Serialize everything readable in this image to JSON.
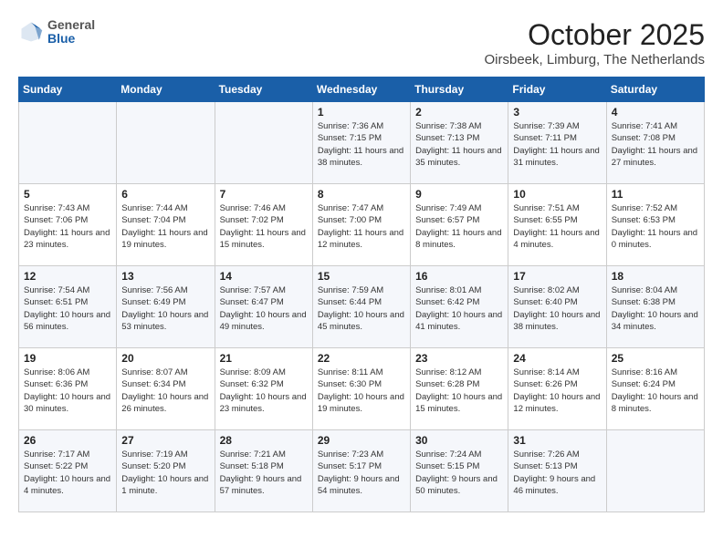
{
  "header": {
    "logo": {
      "general": "General",
      "blue": "Blue"
    },
    "month": "October 2025",
    "location": "Oirsbeek, Limburg, The Netherlands"
  },
  "weekdays": [
    "Sunday",
    "Monday",
    "Tuesday",
    "Wednesday",
    "Thursday",
    "Friday",
    "Saturday"
  ],
  "weeks": [
    [
      {
        "day": null,
        "sunrise": null,
        "sunset": null,
        "daylight": null
      },
      {
        "day": null,
        "sunrise": null,
        "sunset": null,
        "daylight": null
      },
      {
        "day": null,
        "sunrise": null,
        "sunset": null,
        "daylight": null
      },
      {
        "day": "1",
        "sunrise": "Sunrise: 7:36 AM",
        "sunset": "Sunset: 7:15 PM",
        "daylight": "Daylight: 11 hours and 38 minutes."
      },
      {
        "day": "2",
        "sunrise": "Sunrise: 7:38 AM",
        "sunset": "Sunset: 7:13 PM",
        "daylight": "Daylight: 11 hours and 35 minutes."
      },
      {
        "day": "3",
        "sunrise": "Sunrise: 7:39 AM",
        "sunset": "Sunset: 7:11 PM",
        "daylight": "Daylight: 11 hours and 31 minutes."
      },
      {
        "day": "4",
        "sunrise": "Sunrise: 7:41 AM",
        "sunset": "Sunset: 7:08 PM",
        "daylight": "Daylight: 11 hours and 27 minutes."
      }
    ],
    [
      {
        "day": "5",
        "sunrise": "Sunrise: 7:43 AM",
        "sunset": "Sunset: 7:06 PM",
        "daylight": "Daylight: 11 hours and 23 minutes."
      },
      {
        "day": "6",
        "sunrise": "Sunrise: 7:44 AM",
        "sunset": "Sunset: 7:04 PM",
        "daylight": "Daylight: 11 hours and 19 minutes."
      },
      {
        "day": "7",
        "sunrise": "Sunrise: 7:46 AM",
        "sunset": "Sunset: 7:02 PM",
        "daylight": "Daylight: 11 hours and 15 minutes."
      },
      {
        "day": "8",
        "sunrise": "Sunrise: 7:47 AM",
        "sunset": "Sunset: 7:00 PM",
        "daylight": "Daylight: 11 hours and 12 minutes."
      },
      {
        "day": "9",
        "sunrise": "Sunrise: 7:49 AM",
        "sunset": "Sunset: 6:57 PM",
        "daylight": "Daylight: 11 hours and 8 minutes."
      },
      {
        "day": "10",
        "sunrise": "Sunrise: 7:51 AM",
        "sunset": "Sunset: 6:55 PM",
        "daylight": "Daylight: 11 hours and 4 minutes."
      },
      {
        "day": "11",
        "sunrise": "Sunrise: 7:52 AM",
        "sunset": "Sunset: 6:53 PM",
        "daylight": "Daylight: 11 hours and 0 minutes."
      }
    ],
    [
      {
        "day": "12",
        "sunrise": "Sunrise: 7:54 AM",
        "sunset": "Sunset: 6:51 PM",
        "daylight": "Daylight: 10 hours and 56 minutes."
      },
      {
        "day": "13",
        "sunrise": "Sunrise: 7:56 AM",
        "sunset": "Sunset: 6:49 PM",
        "daylight": "Daylight: 10 hours and 53 minutes."
      },
      {
        "day": "14",
        "sunrise": "Sunrise: 7:57 AM",
        "sunset": "Sunset: 6:47 PM",
        "daylight": "Daylight: 10 hours and 49 minutes."
      },
      {
        "day": "15",
        "sunrise": "Sunrise: 7:59 AM",
        "sunset": "Sunset: 6:44 PM",
        "daylight": "Daylight: 10 hours and 45 minutes."
      },
      {
        "day": "16",
        "sunrise": "Sunrise: 8:01 AM",
        "sunset": "Sunset: 6:42 PM",
        "daylight": "Daylight: 10 hours and 41 minutes."
      },
      {
        "day": "17",
        "sunrise": "Sunrise: 8:02 AM",
        "sunset": "Sunset: 6:40 PM",
        "daylight": "Daylight: 10 hours and 38 minutes."
      },
      {
        "day": "18",
        "sunrise": "Sunrise: 8:04 AM",
        "sunset": "Sunset: 6:38 PM",
        "daylight": "Daylight: 10 hours and 34 minutes."
      }
    ],
    [
      {
        "day": "19",
        "sunrise": "Sunrise: 8:06 AM",
        "sunset": "Sunset: 6:36 PM",
        "daylight": "Daylight: 10 hours and 30 minutes."
      },
      {
        "day": "20",
        "sunrise": "Sunrise: 8:07 AM",
        "sunset": "Sunset: 6:34 PM",
        "daylight": "Daylight: 10 hours and 26 minutes."
      },
      {
        "day": "21",
        "sunrise": "Sunrise: 8:09 AM",
        "sunset": "Sunset: 6:32 PM",
        "daylight": "Daylight: 10 hours and 23 minutes."
      },
      {
        "day": "22",
        "sunrise": "Sunrise: 8:11 AM",
        "sunset": "Sunset: 6:30 PM",
        "daylight": "Daylight: 10 hours and 19 minutes."
      },
      {
        "day": "23",
        "sunrise": "Sunrise: 8:12 AM",
        "sunset": "Sunset: 6:28 PM",
        "daylight": "Daylight: 10 hours and 15 minutes."
      },
      {
        "day": "24",
        "sunrise": "Sunrise: 8:14 AM",
        "sunset": "Sunset: 6:26 PM",
        "daylight": "Daylight: 10 hours and 12 minutes."
      },
      {
        "day": "25",
        "sunrise": "Sunrise: 8:16 AM",
        "sunset": "Sunset: 6:24 PM",
        "daylight": "Daylight: 10 hours and 8 minutes."
      }
    ],
    [
      {
        "day": "26",
        "sunrise": "Sunrise: 7:17 AM",
        "sunset": "Sunset: 5:22 PM",
        "daylight": "Daylight: 10 hours and 4 minutes."
      },
      {
        "day": "27",
        "sunrise": "Sunrise: 7:19 AM",
        "sunset": "Sunset: 5:20 PM",
        "daylight": "Daylight: 10 hours and 1 minute."
      },
      {
        "day": "28",
        "sunrise": "Sunrise: 7:21 AM",
        "sunset": "Sunset: 5:18 PM",
        "daylight": "Daylight: 9 hours and 57 minutes."
      },
      {
        "day": "29",
        "sunrise": "Sunrise: 7:23 AM",
        "sunset": "Sunset: 5:17 PM",
        "daylight": "Daylight: 9 hours and 54 minutes."
      },
      {
        "day": "30",
        "sunrise": "Sunrise: 7:24 AM",
        "sunset": "Sunset: 5:15 PM",
        "daylight": "Daylight: 9 hours and 50 minutes."
      },
      {
        "day": "31",
        "sunrise": "Sunrise: 7:26 AM",
        "sunset": "Sunset: 5:13 PM",
        "daylight": "Daylight: 9 hours and 46 minutes."
      },
      {
        "day": null,
        "sunrise": null,
        "sunset": null,
        "daylight": null
      }
    ]
  ]
}
